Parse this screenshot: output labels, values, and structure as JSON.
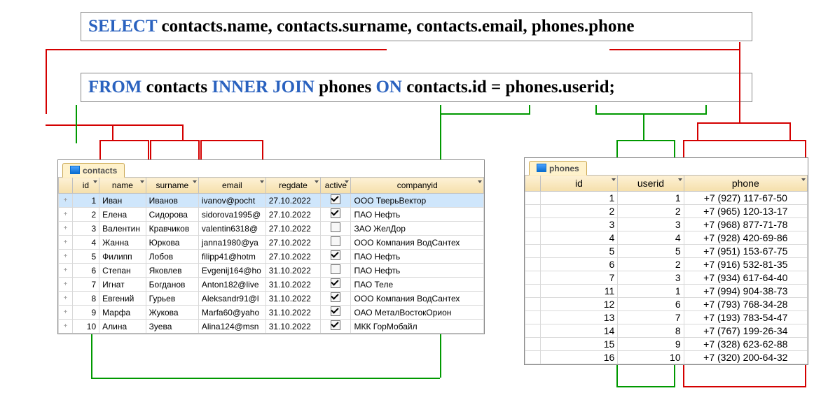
{
  "sql": {
    "line1": {
      "select_kw": "SELECT",
      "cols": " contacts.name, contacts.surname, contacts.email, phones.phone"
    },
    "line2": {
      "from_kw": "FROM",
      "t1": " contacts ",
      "join_kw": "INNER JOIN",
      "t2": " phones ",
      "on_kw": "ON",
      "cond": " contacts.id = phones.userid;"
    }
  },
  "contacts": {
    "tab": "contacts",
    "headers": [
      "id",
      "name",
      "surname",
      "email",
      "regdate",
      "active",
      "companyid"
    ],
    "rows": [
      {
        "id": "1",
        "name": "Иван",
        "surname": "Иванов",
        "email": "ivanov@pocht",
        "regdate": "27.10.2022",
        "active": true,
        "companyid": "ООО ТверьВектор",
        "sel": true
      },
      {
        "id": "2",
        "name": "Елена",
        "surname": "Сидорова",
        "email": "sidorova1995@",
        "regdate": "27.10.2022",
        "active": true,
        "companyid": "ПАО Нефть"
      },
      {
        "id": "3",
        "name": "Валентин",
        "surname": "Кравчиков",
        "email": "valentin6318@",
        "regdate": "27.10.2022",
        "active": false,
        "companyid": "ЗАО ЖелДор"
      },
      {
        "id": "4",
        "name": "Жанна",
        "surname": "Юркова",
        "email": "janna1980@ya",
        "regdate": "27.10.2022",
        "active": false,
        "companyid": "ООО Компания ВодСантех"
      },
      {
        "id": "5",
        "name": "Филипп",
        "surname": "Лобов",
        "email": "filipp41@hotm",
        "regdate": "27.10.2022",
        "active": true,
        "companyid": "ПАО Нефть"
      },
      {
        "id": "6",
        "name": "Степан",
        "surname": "Яковлев",
        "email": "Evgenij164@ho",
        "regdate": "31.10.2022",
        "active": false,
        "companyid": "ПАО Нефть"
      },
      {
        "id": "7",
        "name": "Игнат",
        "surname": "Богданов",
        "email": "Anton182@live",
        "regdate": "31.10.2022",
        "active": true,
        "companyid": "ПАО Теле"
      },
      {
        "id": "8",
        "name": "Евгений",
        "surname": "Гурьев",
        "email": "Aleksandr91@l",
        "regdate": "31.10.2022",
        "active": true,
        "companyid": "ООО Компания ВодСантех"
      },
      {
        "id": "9",
        "name": "Марфа",
        "surname": "Жукова",
        "email": "Marfa60@yaho",
        "regdate": "31.10.2022",
        "active": true,
        "companyid": "ОАО МеталВостокОрион"
      },
      {
        "id": "10",
        "name": "Алина",
        "surname": "Зуева",
        "email": "Alina124@msn",
        "regdate": "31.10.2022",
        "active": true,
        "companyid": "МКК ГорМобайл"
      }
    ]
  },
  "phones": {
    "tab": "phones",
    "headers": [
      "id",
      "userid",
      "phone"
    ],
    "rows": [
      {
        "id": "1",
        "userid": "1",
        "phone": "+7 (927) 117-67-50"
      },
      {
        "id": "2",
        "userid": "2",
        "phone": "+7 (965) 120-13-17"
      },
      {
        "id": "3",
        "userid": "3",
        "phone": "+7 (968) 877-71-78"
      },
      {
        "id": "4",
        "userid": "4",
        "phone": "+7 (928) 420-69-86"
      },
      {
        "id": "5",
        "userid": "5",
        "phone": "+7 (951) 153-67-75"
      },
      {
        "id": "6",
        "userid": "2",
        "phone": "+7 (916) 532-81-35"
      },
      {
        "id": "7",
        "userid": "3",
        "phone": "+7 (934) 617-64-40"
      },
      {
        "id": "11",
        "userid": "1",
        "phone": "+7 (994) 904-38-73"
      },
      {
        "id": "12",
        "userid": "6",
        "phone": "+7 (793) 768-34-28"
      },
      {
        "id": "13",
        "userid": "7",
        "phone": "+7 (193) 783-54-47"
      },
      {
        "id": "14",
        "userid": "8",
        "phone": "+7 (767) 199-26-34"
      },
      {
        "id": "15",
        "userid": "9",
        "phone": "+7 (328) 623-62-88"
      },
      {
        "id": "16",
        "userid": "10",
        "phone": "+7 (320) 200-64-32"
      }
    ]
  }
}
